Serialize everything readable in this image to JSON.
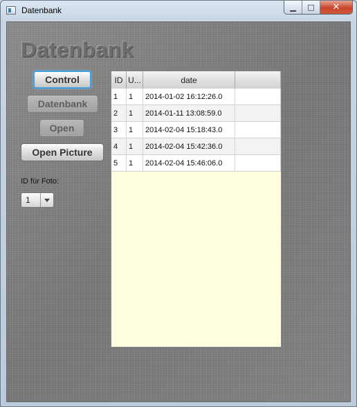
{
  "window": {
    "title": "Datenbank",
    "icon": "app-window-icon"
  },
  "heading": "Datenbank",
  "buttons": {
    "control": "Control",
    "datenbank": "Datenbank",
    "open": "Open",
    "open_picture": "Open Picture"
  },
  "foto": {
    "label": "ID für Foto:",
    "selected": "1"
  },
  "table": {
    "columns": [
      "ID",
      "U...",
      "date",
      ""
    ],
    "rows": [
      [
        "1",
        "1",
        "2014-01-02 16:12:26.0"
      ],
      [
        "2",
        "1",
        "2014-01-11 13:08:59.0"
      ],
      [
        "3",
        "1",
        "2014-02-04 15:18:43.0"
      ],
      [
        "4",
        "1",
        "2014-02-04 15:42:36.0"
      ],
      [
        "5",
        "1",
        "2014-02-04 15:46:06.0"
      ]
    ]
  }
}
